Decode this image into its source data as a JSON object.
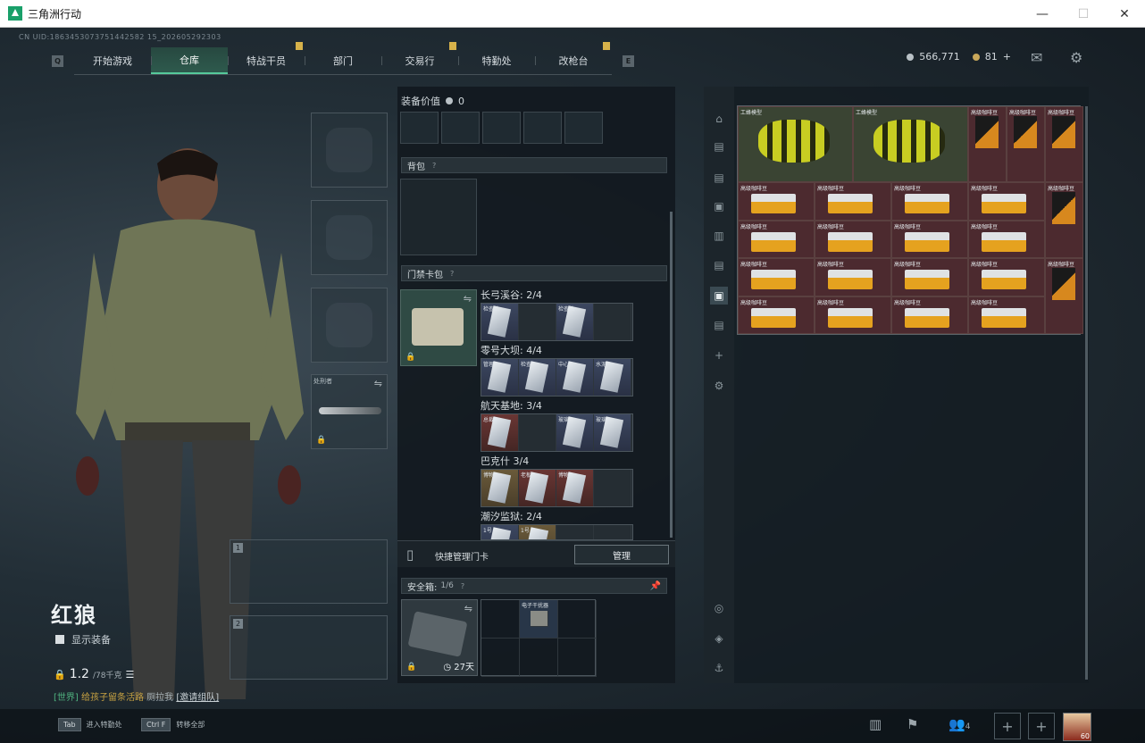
{
  "window": {
    "title": "三角洲行动"
  },
  "header": {
    "uid": "CN UID:1863453073751442582 15_202605292303",
    "tabs": [
      {
        "label": "开始游戏"
      },
      {
        "label": "仓库"
      },
      {
        "label": "特战干员"
      },
      {
        "label": "部门"
      },
      {
        "label": "交易行"
      },
      {
        "label": "特勤处"
      },
      {
        "label": "改枪台"
      }
    ],
    "active_tab": "仓库",
    "key_left": "Q",
    "key_right": "E",
    "silver": "566,771",
    "gold": "81"
  },
  "character": {
    "name": "红狼",
    "show_equipment": "显示装备",
    "weight": "1.2",
    "weight_max": "/78千克"
  },
  "chat": {
    "prefix": "[世界]",
    "text": " 给孩子留条活路 ",
    "mid": "厕拉我",
    "link": "[邀请组队]"
  },
  "equipment": {
    "melee_label": "处刑者",
    "weapon_slots": [
      "1",
      "2"
    ]
  },
  "mid": {
    "value_label": "装备价值",
    "value": "0",
    "backpack_label": "背包",
    "keycard_label": "门禁卡包",
    "maps": [
      {
        "name": "长弓溪谷: 2/4",
        "cards": [
          {
            "name": "检查站",
            "style": "filled"
          },
          {
            "name": "",
            "style": "empty"
          },
          {
            "name": "检查站",
            "style": "filled"
          },
          {
            "name": "",
            "style": "empty"
          }
        ]
      },
      {
        "name": "零号大坝: 4/4",
        "cards": [
          {
            "name": "管理",
            "style": "filled"
          },
          {
            "name": "检查",
            "style": "filled"
          },
          {
            "name": "中心",
            "style": "filled"
          },
          {
            "name": "水泥",
            "style": "filled"
          }
        ]
      },
      {
        "name": "航天基地: 3/4",
        "cards": [
          {
            "name": "总裁",
            "style": "red"
          },
          {
            "name": "",
            "style": "empty"
          },
          {
            "name": "玻璃",
            "style": "filled"
          },
          {
            "name": "玻璃",
            "style": "filled"
          }
        ]
      },
      {
        "name": "巴克什 3/4",
        "cards": [
          {
            "name": "博物",
            "style": "gold"
          },
          {
            "name": "老板",
            "style": "red"
          },
          {
            "name": "博物",
            "style": "red"
          },
          {
            "name": "",
            "style": "empty"
          }
        ]
      },
      {
        "name": "潮汐监狱: 2/4",
        "cards": [
          {
            "name": "1号",
            "style": "filled"
          },
          {
            "name": "1号",
            "style": "gold"
          },
          {
            "name": "",
            "style": "empty"
          },
          {
            "name": "",
            "style": "empty"
          }
        ]
      }
    ],
    "quick_manage": "快捷管理门卡",
    "manage_btn": "管理",
    "safe_label": "安全箱: ",
    "safe_count": "1/6",
    "safe_days": "27天",
    "safe_item": "电子干扰器"
  },
  "stash": {
    "title": "仓库",
    "items": [
      {
        "name": "工蜂模型",
        "kind": "bee"
      },
      {
        "name": "工蜂模型",
        "kind": "bee"
      },
      {
        "name": "高级咖啡豆",
        "kind": "coffee"
      },
      {
        "name": "高级咖啡豆",
        "kind": "coffee"
      },
      {
        "name": "高级咖啡豆",
        "kind": "coffee"
      },
      {
        "name": "高级咖啡豆",
        "kind": "crate"
      },
      {
        "name": "高级咖啡豆",
        "kind": "crate"
      }
    ],
    "crate_label": "高级咖啡豆"
  },
  "bottom": {
    "tab_key": "Tab",
    "tab_action": "进入特勤处",
    "ctrl_key": "Ctrl F",
    "ctrl_action": "转移全部",
    "friends": "4",
    "avatar_level": "60"
  }
}
